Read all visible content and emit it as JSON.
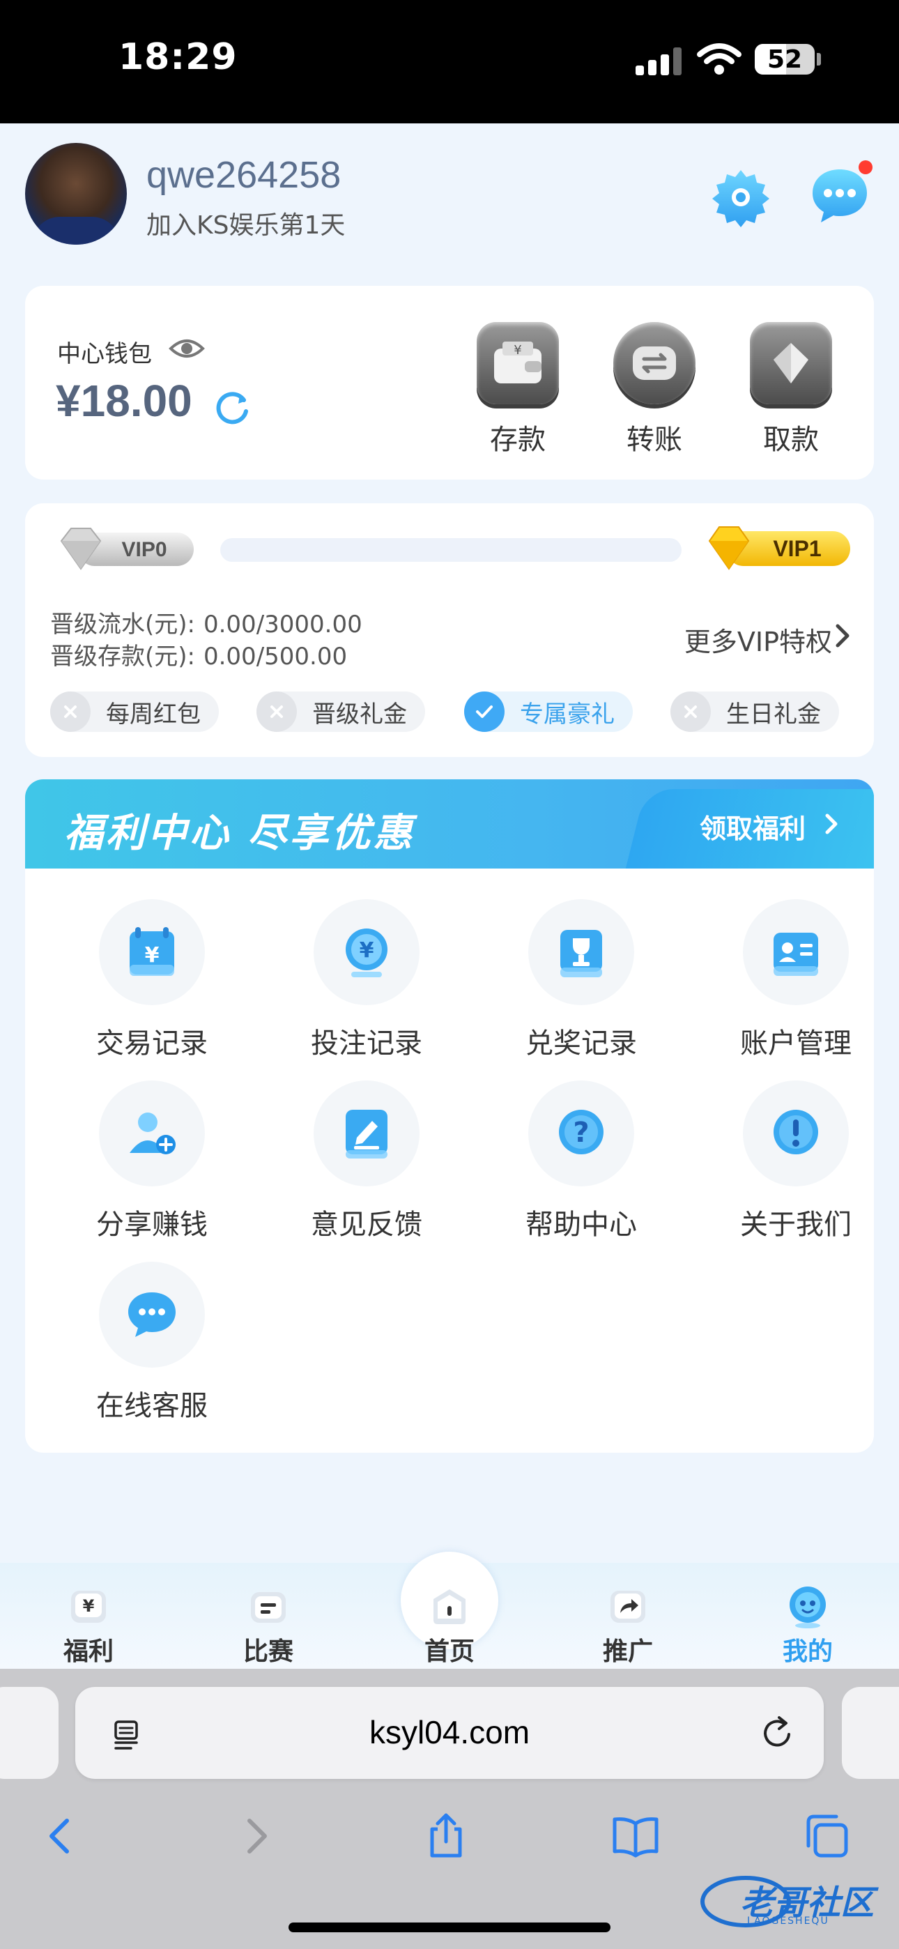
{
  "status_bar": {
    "time": "18:29",
    "battery": "52",
    "battery_level": 0.52
  },
  "profile": {
    "username": "qwe264258",
    "join_text": "加入KS娱乐第1天"
  },
  "wallet": {
    "label": "中心钱包",
    "amount": "¥18.00",
    "actions": [
      {
        "label": "存款",
        "icon": "wallet-icon"
      },
      {
        "label": "转账",
        "icon": "transfer-icon"
      },
      {
        "label": "取款",
        "icon": "diamond-icon"
      }
    ]
  },
  "vip": {
    "current": "VIP0",
    "next": "VIP1",
    "progress": 0.0,
    "turnover_label": "晋级流水(元):",
    "turnover_value": "0.00/3000.00",
    "deposit_label": "晋级存款(元):",
    "deposit_value": "0.00/500.00",
    "more_label": "更多VIP特权",
    "perks": [
      {
        "label": "每周红包",
        "active": false
      },
      {
        "label": "晋级礼金",
        "active": false
      },
      {
        "label": "专属豪礼",
        "active": true
      },
      {
        "label": "生日礼金",
        "active": false
      }
    ]
  },
  "welfare": {
    "title": "福利中心 尽享优惠",
    "claim_label": "领取福利",
    "items": [
      {
        "label": "交易记录",
        "icon": "transaction-record-icon"
      },
      {
        "label": "投注记录",
        "icon": "bet-record-icon"
      },
      {
        "label": "兑奖记录",
        "icon": "prize-record-icon"
      },
      {
        "label": "账户管理",
        "icon": "account-card-icon"
      },
      {
        "label": "分享赚钱",
        "icon": "share-earn-icon"
      },
      {
        "label": "意见反馈",
        "icon": "feedback-icon"
      },
      {
        "label": "帮助中心",
        "icon": "help-icon"
      },
      {
        "label": "关于我们",
        "icon": "info-icon"
      },
      {
        "label": "在线客服",
        "icon": "chat-support-icon"
      }
    ]
  },
  "tabbar": {
    "items": [
      {
        "label": "福利",
        "icon": "yen-gift-icon",
        "active": false
      },
      {
        "label": "比赛",
        "icon": "calendar-icon",
        "active": false
      },
      {
        "label": "首页",
        "icon": "home-icon",
        "active": false
      },
      {
        "label": "推广",
        "icon": "share-arrow-icon",
        "active": false
      },
      {
        "label": "我的",
        "icon": "mascot-face-icon",
        "active": true
      }
    ]
  },
  "browser": {
    "url": "ksyl04.com"
  },
  "watermark": {
    "text": "老哥社区",
    "sub": "LAOGESHEQU"
  },
  "colors": {
    "accent": "#3fa9f5",
    "vip_gold": "#f5c518",
    "banner": "#40c6e8"
  }
}
